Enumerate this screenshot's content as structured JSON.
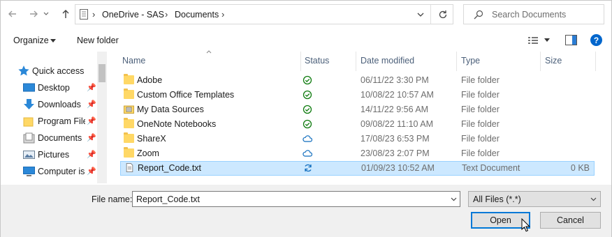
{
  "address_bar": {
    "breadcrumbs": [
      "OneDrive - SAS",
      "Documents"
    ],
    "refresh_icon": "refresh-icon"
  },
  "search": {
    "placeholder": "Search Documents"
  },
  "toolbar": {
    "organize_label": "Organize",
    "new_folder_label": "New folder"
  },
  "nav_pane": {
    "items": [
      {
        "label": "Quick access",
        "icon": "star-icon"
      },
      {
        "label": "Desktop",
        "icon": "desktop-icon",
        "pinned": true
      },
      {
        "label": "Downloads",
        "icon": "download-arrow-icon",
        "pinned": true
      },
      {
        "label": "Program File",
        "icon": "folder-icon",
        "pinned": true
      },
      {
        "label": "Documents",
        "icon": "documents-icon",
        "pinned": true
      },
      {
        "label": "Pictures",
        "icon": "pictures-icon",
        "pinned": true
      },
      {
        "label": "Computer is",
        "icon": "computer-icon",
        "pinned": true
      }
    ]
  },
  "file_list": {
    "columns": [
      "Name",
      "Status",
      "Date modified",
      "Type",
      "Size"
    ],
    "rows": [
      {
        "name": "Adobe",
        "status": "synced",
        "date": "06/11/22 3:30 PM",
        "type": "File folder",
        "size": ""
      },
      {
        "name": "Custom Office Templates",
        "status": "synced",
        "date": "10/08/22 10:57 AM",
        "type": "File folder",
        "size": ""
      },
      {
        "name": "My Data Sources",
        "status": "synced",
        "date": "14/11/22 9:56 AM",
        "type": "File folder",
        "size": ""
      },
      {
        "name": "OneNote Notebooks",
        "status": "synced",
        "date": "09/08/22 11:10 AM",
        "type": "File folder",
        "size": ""
      },
      {
        "name": "ShareX",
        "status": "cloud",
        "date": "17/08/23 6:53 PM",
        "type": "File folder",
        "size": ""
      },
      {
        "name": "Zoom",
        "status": "cloud",
        "date": "23/08/23 2:07 PM",
        "type": "File folder",
        "size": ""
      },
      {
        "name": "Report_Code.txt",
        "status": "syncing",
        "date": "01/09/23 10:52 AM",
        "type": "Text Document",
        "size": "0 KB"
      }
    ]
  },
  "footer": {
    "file_name_label": "File name:",
    "file_name_value": "Report_Code.txt",
    "file_type_value": "All Files (*.*)",
    "open_label": "Open",
    "cancel_label": "Cancel"
  },
  "colors": {
    "accent": "#0078d7",
    "selection_bg": "#cce8ff",
    "synced": "#107c10",
    "cloud": "#0f6cbd"
  }
}
